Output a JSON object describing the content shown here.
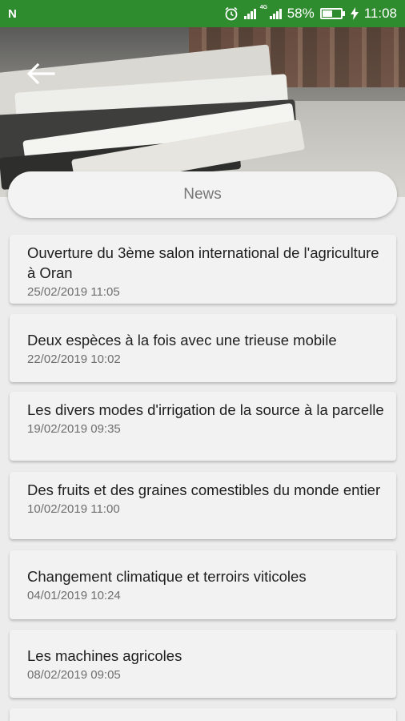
{
  "status_bar": {
    "network_glyph": "N",
    "signal_tag": "4G",
    "battery_percent": "58%",
    "battery_level": 0.58,
    "time": "11:08"
  },
  "header": {
    "back_icon": "arrow-left-icon"
  },
  "page": {
    "title": "News"
  },
  "news": [
    {
      "title": "Ouverture du 3ème salon international de l'agriculture à Oran",
      "date": "25/02/2019 11:05"
    },
    {
      "title": "Deux espèces à la fois avec une trieuse mobile",
      "date": "22/02/2019 10:02"
    },
    {
      "title": "Les divers modes d'irrigation de la source à la parcelle",
      "date": "19/02/2019 09:35"
    },
    {
      "title": "Des fruits et des graines comestibles du monde entier",
      "date": "10/02/2019 11:00"
    },
    {
      "title": "Changement climatique et terroirs viticoles",
      "date": "04/01/2019 10:24"
    },
    {
      "title": "Les machines agricoles",
      "date": "08/02/2019 09:05"
    }
  ]
}
